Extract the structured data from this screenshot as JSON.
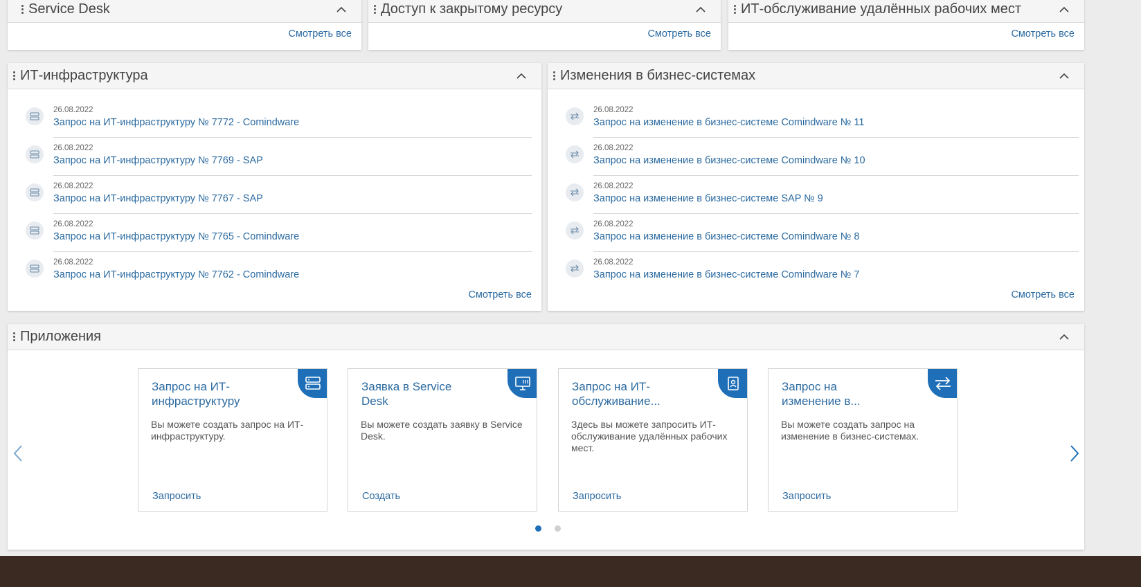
{
  "colors": {
    "link": "#2b6aa0",
    "accent": "#1e6fb8",
    "header_bg": "#f5f5f5",
    "page_bg": "#ececec"
  },
  "top_panels": [
    {
      "title": "Service Desk",
      "see_all": "Смотреть все"
    },
    {
      "title": "Доступ к закрытому ресурсу",
      "see_all": "Смотреть все"
    },
    {
      "title": "ИТ-обслуживание удалённых рабочих мест",
      "see_all": "Смотреть все"
    }
  ],
  "infra": {
    "title": "ИТ-инфраструктура",
    "see_all": "Смотреть все",
    "icon": "server-icon",
    "items": [
      {
        "date": "26.08.2022",
        "label": "Запрос на ИТ-инфраструктуру № 7772 - Comindware"
      },
      {
        "date": "26.08.2022",
        "label": "Запрос на ИТ-инфраструктуру № 7769 - SAP"
      },
      {
        "date": "26.08.2022",
        "label": "Запрос на ИТ-инфраструктуру № 7767 - SAP"
      },
      {
        "date": "26.08.2022",
        "label": "Запрос на ИТ-инфраструктуру № 7765 - Comindware"
      },
      {
        "date": "26.08.2022",
        "label": "Запрос на ИТ-инфраструктуру № 7762 - Comindware"
      }
    ]
  },
  "changes": {
    "title": "Изменения в бизнес-системах",
    "see_all": "Смотреть все",
    "icon": "swap-arrows-icon",
    "items": [
      {
        "date": "26.08.2022",
        "label": "Запрос на изменение в бизнес-системе Comindware № 11"
      },
      {
        "date": "26.08.2022",
        "label": "Запрос на изменение в бизнес-системе Comindware № 10"
      },
      {
        "date": "26.08.2022",
        "label": "Запрос на изменение в бизнес-системе SAP № 9"
      },
      {
        "date": "26.08.2022",
        "label": "Запрос на изменение в бизнес-системе Comindware № 8"
      },
      {
        "date": "26.08.2022",
        "label": "Запрос на изменение в бизнес-системе Comindware № 7"
      }
    ]
  },
  "apps": {
    "title": "Приложения",
    "cards": [
      {
        "title": "Запрос на ИТ-инфраструктуру",
        "desc": "Вы можете создать запрос на ИТ-инфраструктуру.",
        "action": "Запросить",
        "icon": "server-icon"
      },
      {
        "title": "Заявка в Service Desk",
        "desc": "Вы можете создать заявку в Service Desk.",
        "action": "Создать",
        "icon": "monitor-icon"
      },
      {
        "title": "Запрос на ИТ-обслуживание...",
        "desc": "Здесь вы можете запросить ИТ-обслуживание удалённых рабочих мест.",
        "action": "Запросить",
        "icon": "badge-icon"
      },
      {
        "title": "Запрос на изменение в...",
        "desc": "Вы можете создать запрос на изменение в бизнес-системах.",
        "action": "Запросить",
        "icon": "swap-arrows-icon"
      }
    ],
    "pages": 2,
    "active_page": 1
  }
}
